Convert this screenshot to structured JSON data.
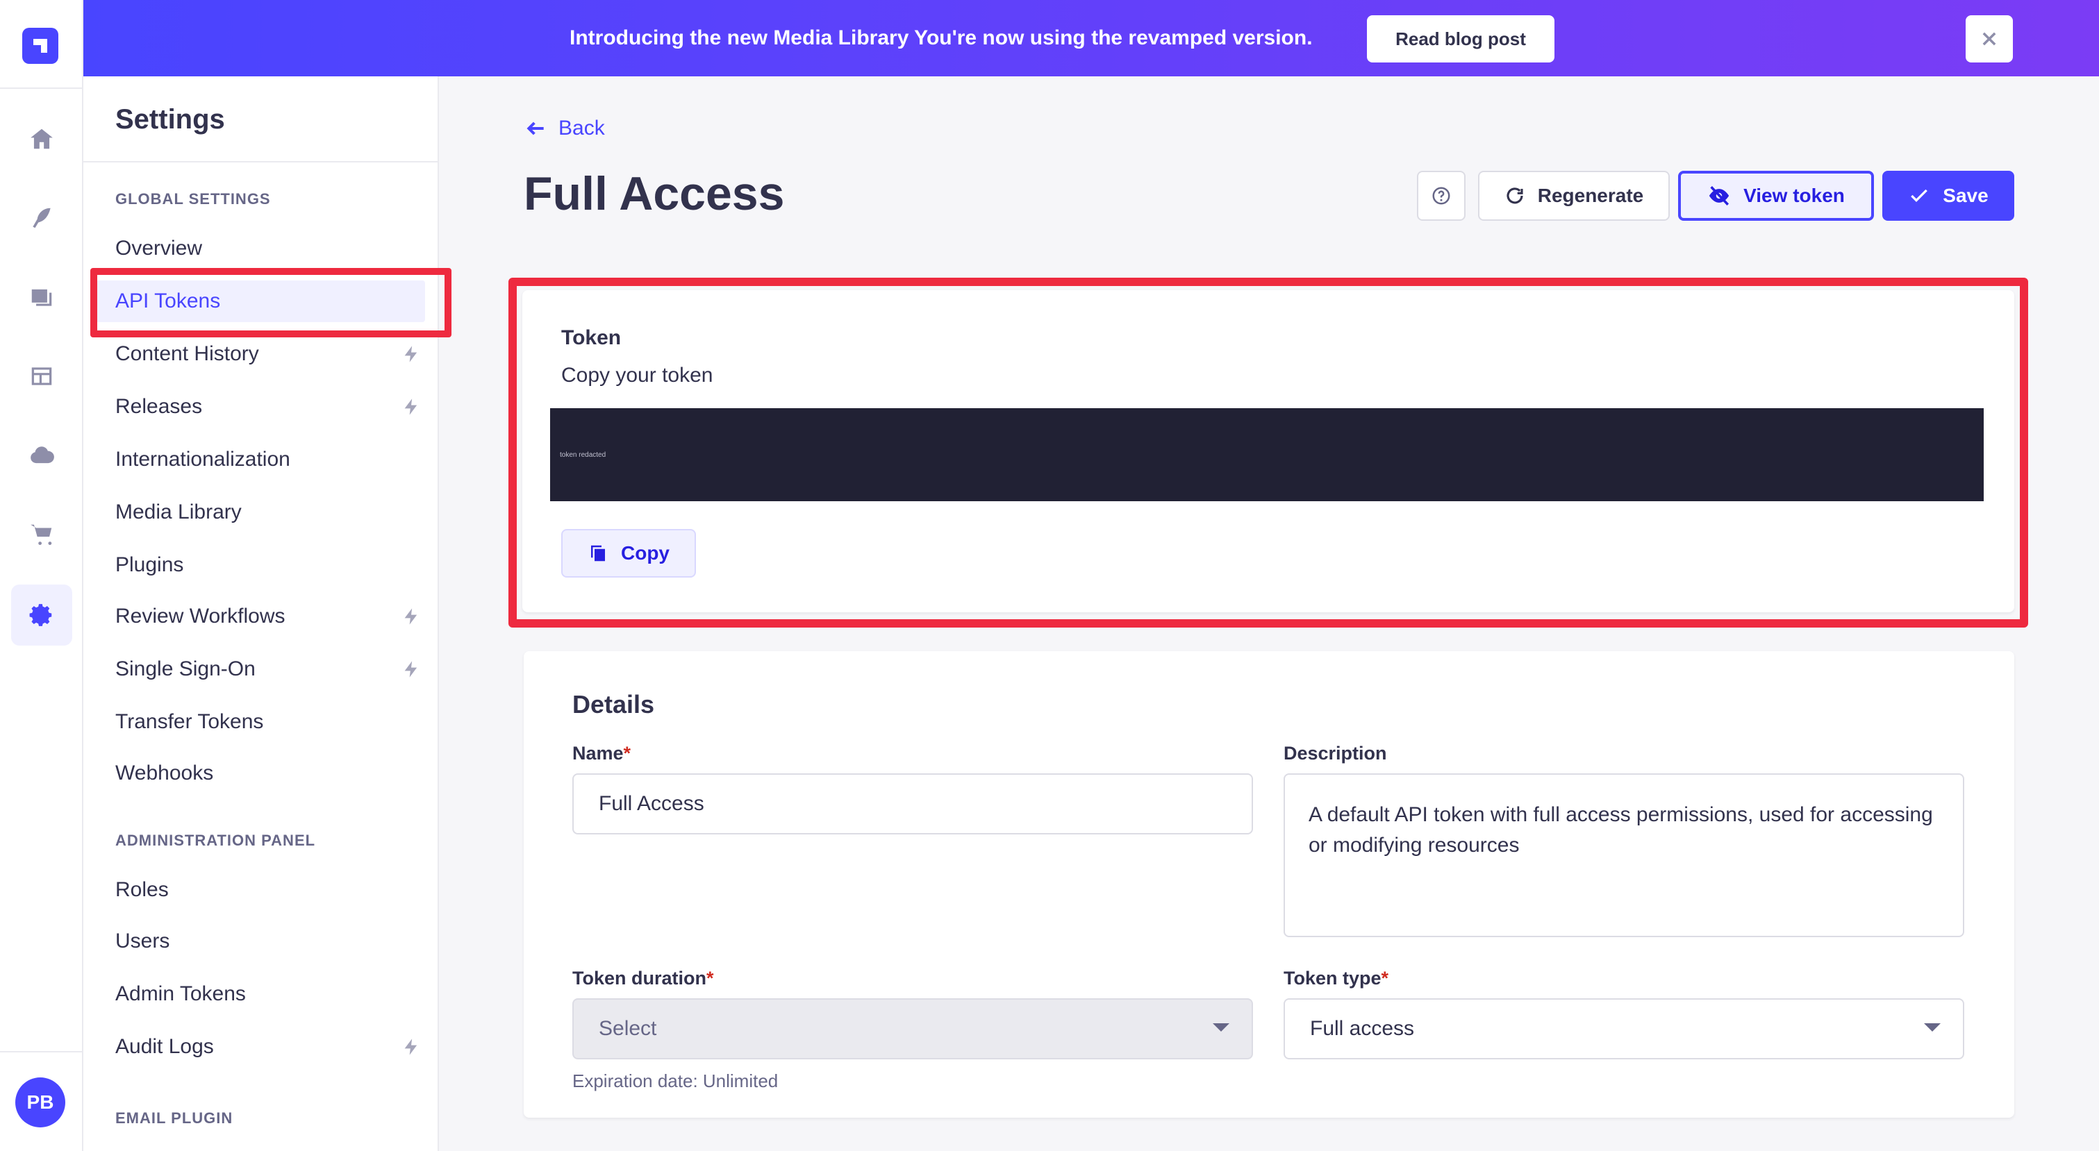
{
  "colors": {
    "primary": "#4945ff",
    "highlight": "#ee2a3f",
    "banner_gradient_start": "#4945ff",
    "banner_gradient_end": "#7b3cf5"
  },
  "main_nav": {
    "icons": [
      "home-icon",
      "feather-icon",
      "media-icon",
      "layout-icon",
      "cloud-icon",
      "cart-icon",
      "gear-icon"
    ],
    "avatar_initials": "PB"
  },
  "banner": {
    "text": "Introducing the new Media Library You're now using the revamped version.",
    "button_label": "Read blog post"
  },
  "settings_nav": {
    "title": "Settings",
    "sections": [
      {
        "label": "GLOBAL SETTINGS",
        "items": [
          {
            "label": "Overview"
          },
          {
            "label": "API Tokens",
            "active": true
          },
          {
            "label": "Content History",
            "premium": true
          },
          {
            "label": "Releases",
            "premium": true
          },
          {
            "label": "Internationalization"
          },
          {
            "label": "Media Library"
          },
          {
            "label": "Plugins"
          },
          {
            "label": "Review Workflows",
            "premium": true
          },
          {
            "label": "Single Sign-On",
            "premium": true
          },
          {
            "label": "Transfer Tokens"
          },
          {
            "label": "Webhooks"
          }
        ]
      },
      {
        "label": "ADMINISTRATION PANEL",
        "items": [
          {
            "label": "Roles"
          },
          {
            "label": "Users"
          },
          {
            "label": "Admin Tokens"
          },
          {
            "label": "Audit Logs",
            "premium": true
          }
        ]
      },
      {
        "label": "EMAIL PLUGIN",
        "items": []
      }
    ]
  },
  "header": {
    "back_label": "Back",
    "title": "Full Access",
    "regenerate_label": "Regenerate",
    "view_token_label": "View token",
    "save_label": "Save"
  },
  "token": {
    "label": "Token",
    "hint": "Copy your token",
    "value": "token redacted",
    "copy_label": "Copy"
  },
  "details": {
    "title": "Details",
    "name": {
      "label": "Name",
      "required": "*",
      "value": "Full Access"
    },
    "description": {
      "label": "Description",
      "value": "A default API token with full access permissions, used for accessing or modifying resources"
    },
    "token_duration": {
      "label": "Token duration",
      "required": "*",
      "value": "Select",
      "hint": "Expiration date: Unlimited"
    },
    "token_type": {
      "label": "Token type",
      "required": "*",
      "value": "Full access"
    }
  }
}
